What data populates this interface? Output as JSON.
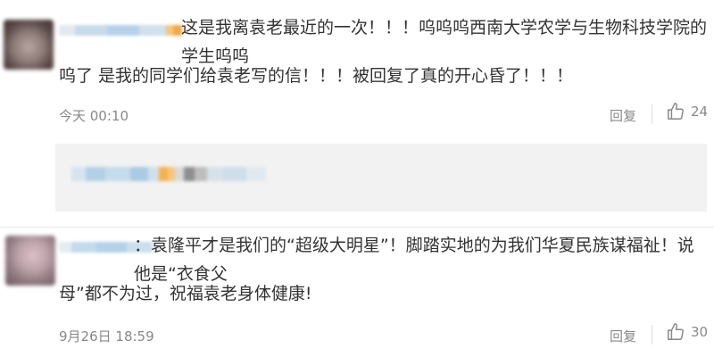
{
  "comments": [
    {
      "text_line1": "这是我离袁老最近的一次！！！呜呜呜西南大学农学与生物科技学院的学生呜呜",
      "text_line2": "呜了 是我的同学们给袁老写的信！！！被回复了真的开心昏了！！！",
      "time": "今天 00:10",
      "reply_label": "回复",
      "likes": "24"
    },
    {
      "text_line1": "：袁隆平才是我们的“超级大明星”！脚踏实地的为我们华夏民族谋福祉！说他是“衣食父",
      "text_line2": "母”都不为过，祝福袁老身体健康!",
      "time": "9月26日 18:59",
      "reply_label": "回复",
      "likes": "30"
    }
  ],
  "icons": {
    "like": "thumbs-up-icon"
  },
  "colors": {
    "text": "#333333",
    "meta": "#888888",
    "subbox": "#f2f2f2"
  }
}
